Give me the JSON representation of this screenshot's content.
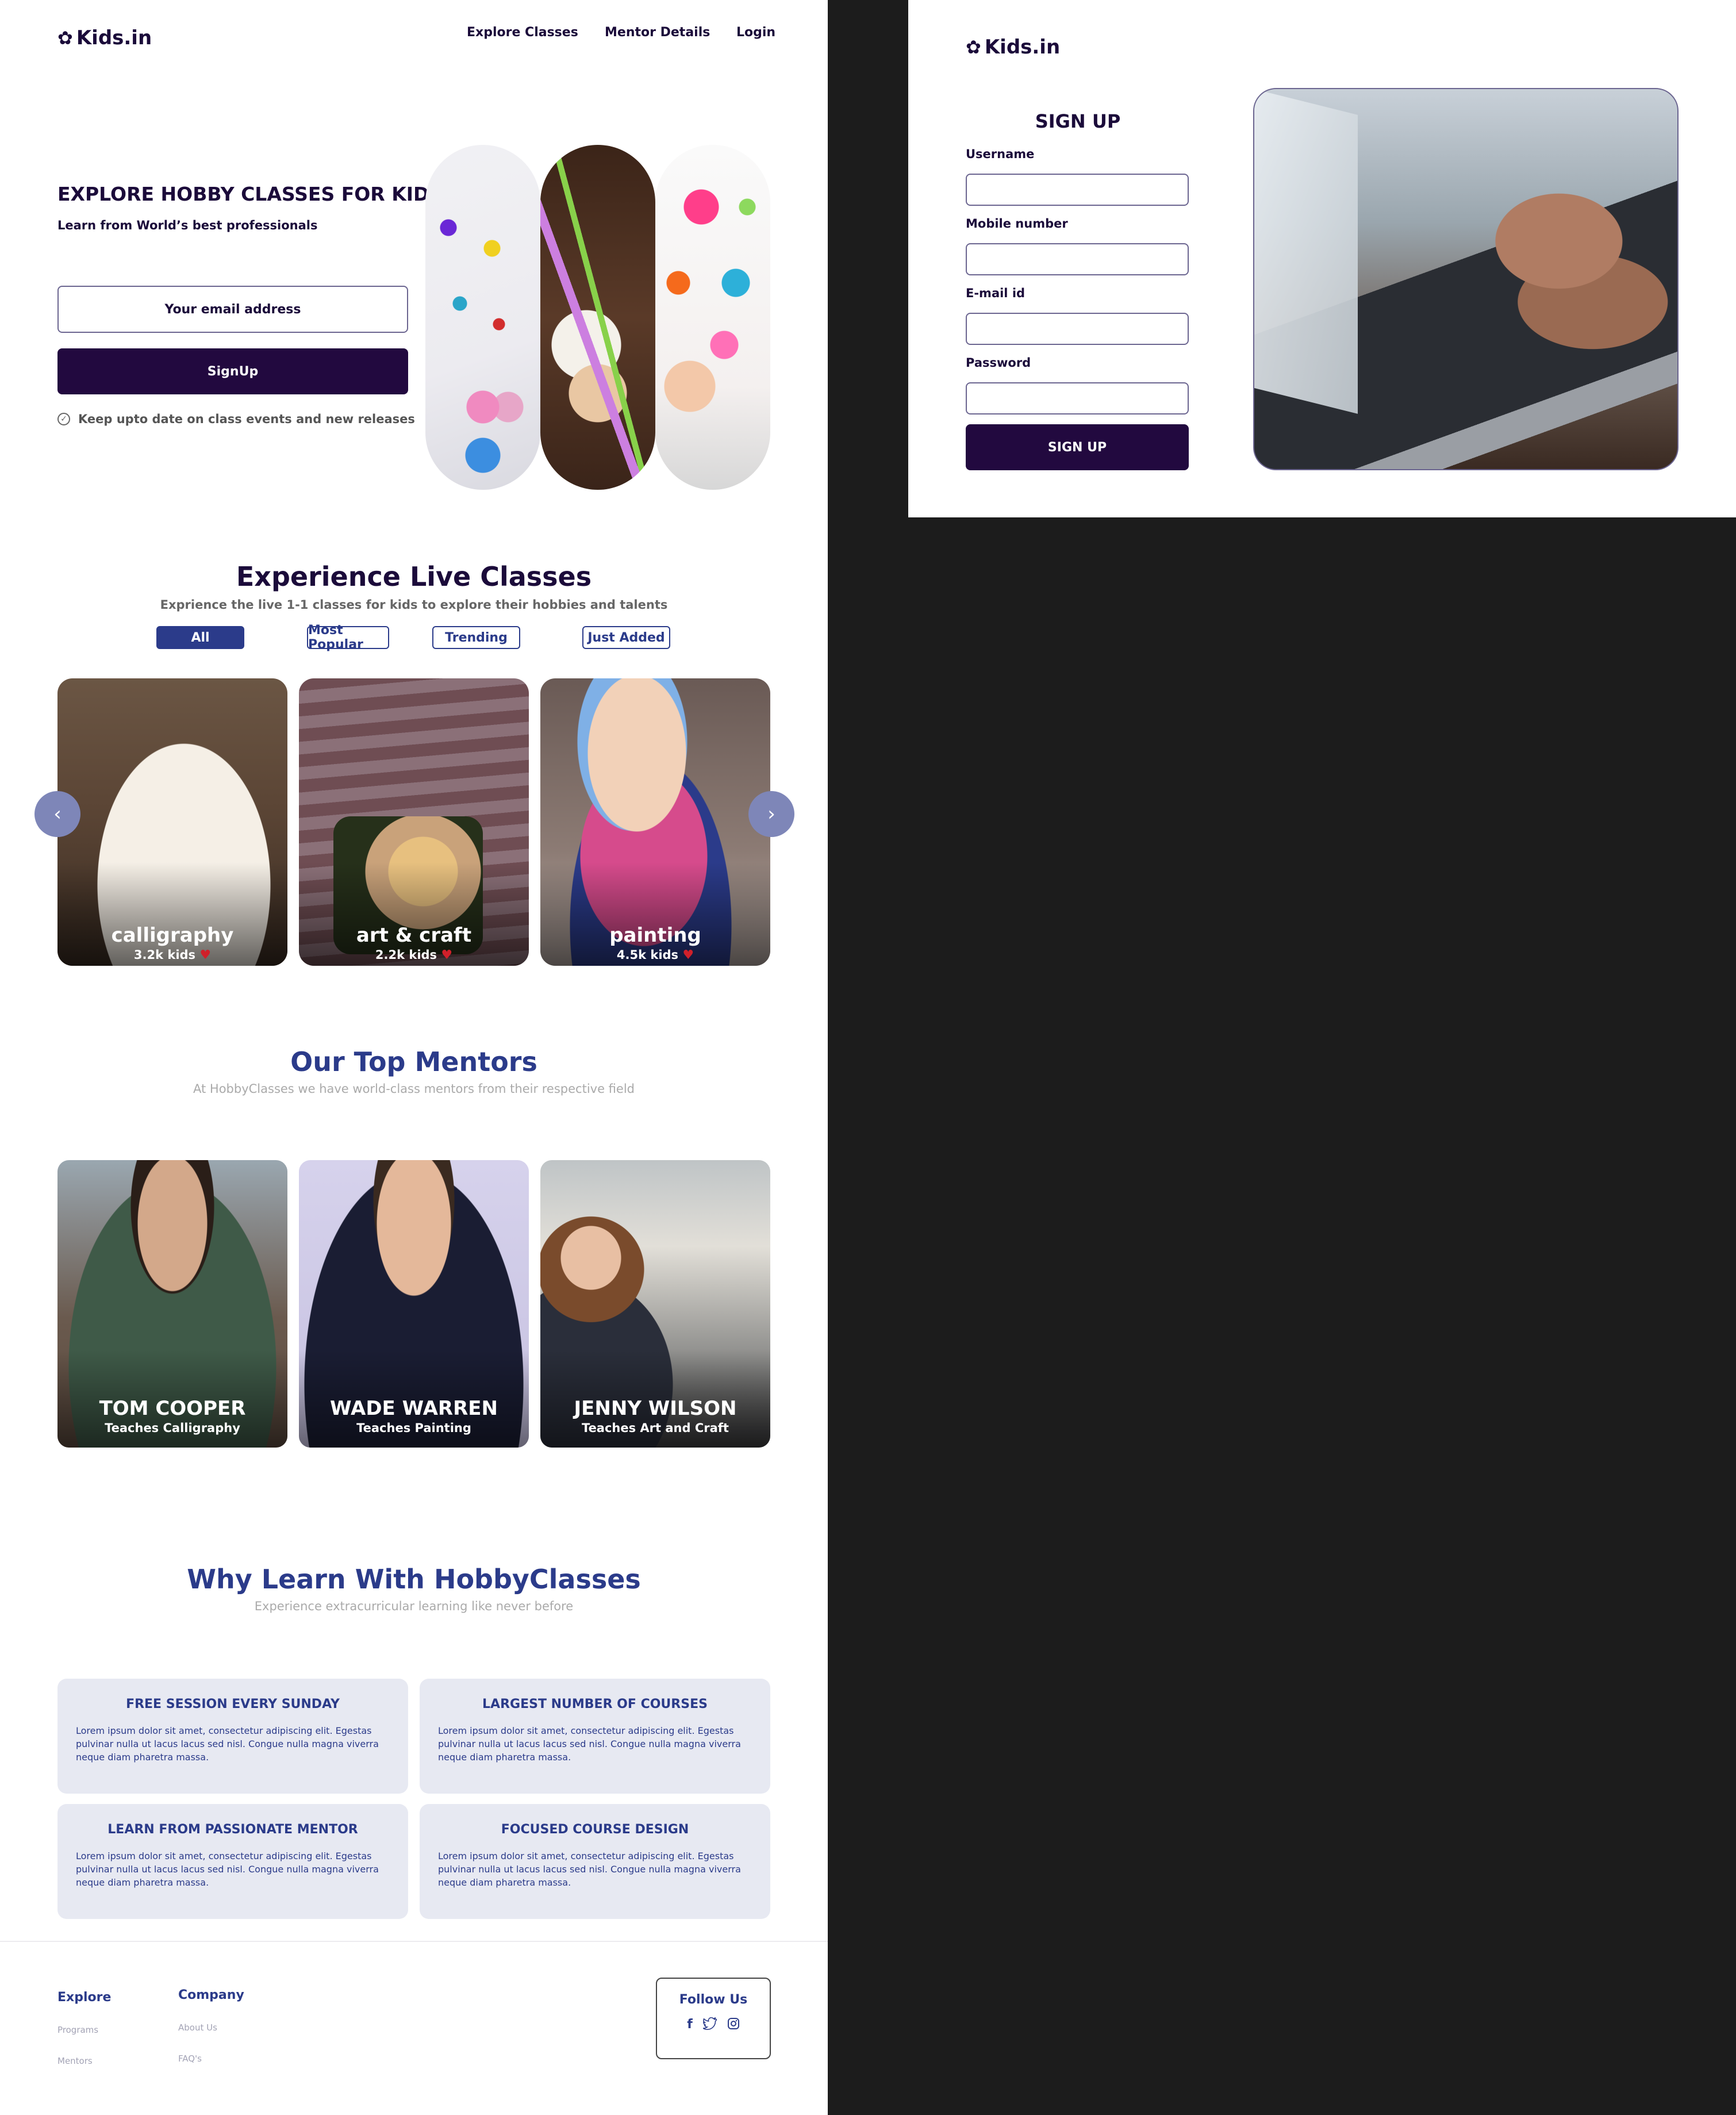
{
  "landing": {
    "logo": "Kids.in",
    "nav": [
      "Explore Classes",
      "Mentor Details",
      "Login"
    ],
    "hero": {
      "title": "EXPLORE HOBBY CLASSES FOR KIDS",
      "subtitle": "Learn from World’s best professionals",
      "email_placeholder": "Your email address",
      "signup_label": "SignUp",
      "keep_updated": "Keep upto date on class events and new releases"
    },
    "live": {
      "title": "Experience Live Classes",
      "subtitle": "Exprience the live 1-1 classes for kids to explore their hobbies and talents",
      "filters": [
        "All",
        "Most Popular",
        "Trending",
        "Just Added"
      ],
      "cards": [
        {
          "name": "calligraphy",
          "kids": "3.2k kids"
        },
        {
          "name": "art & craft",
          "kids": "2.2k kids"
        },
        {
          "name": "painting",
          "kids": "4.5k kids"
        }
      ]
    },
    "mentors": {
      "title": "Our Top Mentors",
      "subtitle": "At HobbyClasses we have world-class mentors from their respective field",
      "list": [
        {
          "name": "TOM COOPER",
          "teaches": "Teaches Calligraphy"
        },
        {
          "name": "WADE WARREN",
          "teaches": "Teaches Painting"
        },
        {
          "name": "JENNY WILSON",
          "teaches": "Teaches Art and Craft"
        }
      ]
    },
    "why": {
      "title": "Why Learn With HobbyClasses",
      "subtitle": "Experience extracurricular learning like never before",
      "items": [
        {
          "title": "FREE SESSION EVERY SUNDAY",
          "body": "Lorem ipsum dolor sit amet, consectetur adipiscing elit. Egestas pulvinar nulla ut lacus lacus sed nisl. Congue nulla magna viverra neque diam pharetra massa."
        },
        {
          "title": "LARGEST NUMBER OF COURSES",
          "body": "Lorem ipsum dolor sit amet, consectetur adipiscing elit. Egestas pulvinar nulla ut lacus lacus sed nisl. Congue nulla magna viverra neque diam pharetra massa."
        },
        {
          "title": "LEARN FROM PASSIONATE MENTOR",
          "body": "Lorem ipsum dolor sit amet, consectetur adipiscing elit. Egestas pulvinar nulla ut lacus lacus sed nisl. Congue nulla magna viverra neque diam pharetra massa."
        },
        {
          "title": "FOCUSED COURSE DESIGN",
          "body": "Lorem ipsum dolor sit amet, consectetur adipiscing elit. Egestas pulvinar nulla ut lacus lacus sed nisl. Congue nulla magna viverra neque diam pharetra massa."
        }
      ]
    },
    "footer": {
      "explore": {
        "title": "Explore",
        "links": [
          "Programs",
          "Mentors"
        ]
      },
      "company": {
        "title": "Company",
        "links": [
          "About Us",
          "FAQ's"
        ]
      },
      "follow": "Follow Us",
      "socials": [
        "facebook-icon",
        "twitter-icon",
        "instagram-icon"
      ]
    }
  },
  "signup": {
    "logo": "Kids.in",
    "title": "SIGN UP",
    "fields": [
      "Username",
      "Mobile number",
      "E-mail id",
      "Password"
    ],
    "button": "SIGN UP"
  },
  "colors": {
    "brand_dark": "#22093f",
    "accent_blue": "#2b3b8a",
    "card_bg": "#e7e9f2",
    "backdrop": "#1c1c1c"
  }
}
